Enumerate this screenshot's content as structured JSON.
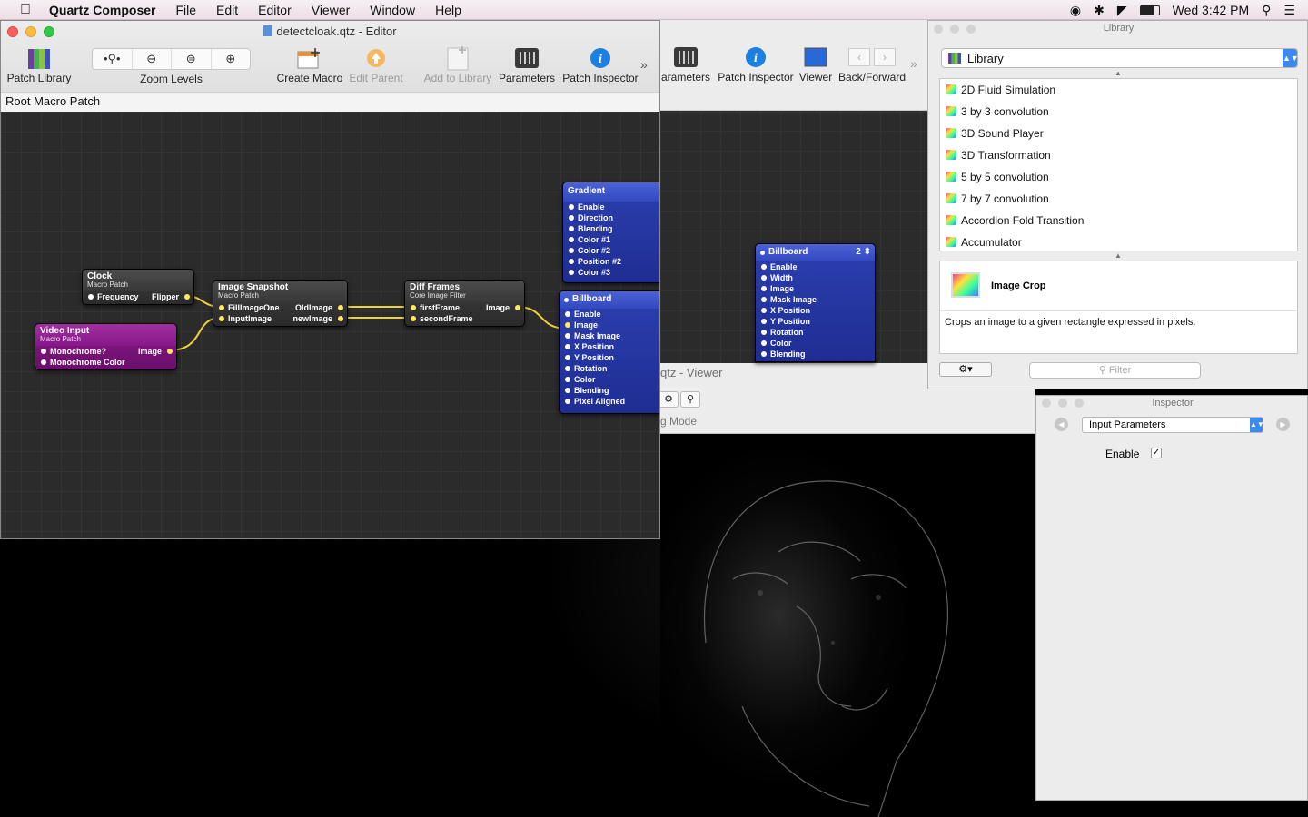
{
  "menubar": {
    "apple": "",
    "app_name": "Quartz Composer",
    "items": [
      "File",
      "Edit",
      "Editor",
      "Viewer",
      "Window",
      "Help"
    ],
    "clock": "Wed 3:42 PM"
  },
  "editor": {
    "title": "detectcloak.qtz - Editor",
    "toolbar": {
      "patch_library": "Patch Library",
      "zoom_levels": "Zoom Levels",
      "create_macro": "Create Macro",
      "edit_parent": "Edit Parent",
      "add_to_library": "Add to Library",
      "parameters": "Parameters",
      "patch_inspector": "Patch Inspector",
      "more": "»"
    },
    "breadcrumb": "Root Macro Patch"
  },
  "editor2": {
    "toolbar": {
      "parameters": "arameters",
      "patch_inspector": "Patch Inspector",
      "viewer": "Viewer",
      "back_forward": "Back/Forward",
      "more": "»"
    }
  },
  "viewer": {
    "title": "qtz - Viewer",
    "mode": "g Mode"
  },
  "patches": {
    "clock": {
      "title": "Clock",
      "subtitle": "Macro Patch",
      "in": "Frequency",
      "out": "Flipper"
    },
    "video_input": {
      "title": "Video Input",
      "subtitle": "Macro Patch",
      "inputs": [
        "Monochrome?",
        "Monochrome Color"
      ],
      "out": "Image"
    },
    "image_snapshot": {
      "title": "Image Snapshot",
      "subtitle": "Macro Patch",
      "inputs": [
        "FillImageOne",
        "InputImage"
      ],
      "outputs": [
        "OldImage",
        "newImage"
      ]
    },
    "diff_frames": {
      "title": "Diff Frames",
      "subtitle": "Core Image Filter",
      "inputs": [
        "firstFrame",
        "secondFrame"
      ],
      "out": "Image"
    },
    "gradient": {
      "title": "Gradient",
      "inputs": [
        "Enable",
        "Direction",
        "Blending",
        "Color #1",
        "Color #2",
        "Position #2",
        "Color #3"
      ]
    },
    "billboard1": {
      "title": "Billboard",
      "inputs": [
        "Enable",
        "Image",
        "Mask Image",
        "X Position",
        "Y Position",
        "Rotation",
        "Color",
        "Blending",
        "Pixel Aligned"
      ]
    },
    "billboard2": {
      "title": "Billboard",
      "badge": "2",
      "inputs": [
        "Enable",
        "Width",
        "Image",
        "Mask Image",
        "X Position",
        "Y Position",
        "Rotation",
        "Color",
        "Blending"
      ]
    }
  },
  "library": {
    "title": "Library",
    "selector": "Library",
    "items": [
      "2D Fluid Simulation",
      "3 by 3 convolution",
      "3D Sound Player",
      "3D Transformation",
      "5 by 5 convolution",
      "7 by 7 convolution",
      "Accordion Fold Transition",
      "Accumulator"
    ],
    "detail_title": "Image Crop",
    "detail_desc": "Crops an image to a given rectangle expressed in pixels.",
    "filter_placeholder": "Filter"
  },
  "inspector": {
    "title": "Inspector",
    "selector": "Input Parameters",
    "enable_label": "Enable",
    "enable_checked": "✓"
  },
  "colors": {
    "patch_blue": "#2c3fb0",
    "patch_purple": "#8a1a88",
    "patch_grey": "#3a3a3a",
    "wire": "#f1d13a",
    "accent": "#3b8af0"
  }
}
